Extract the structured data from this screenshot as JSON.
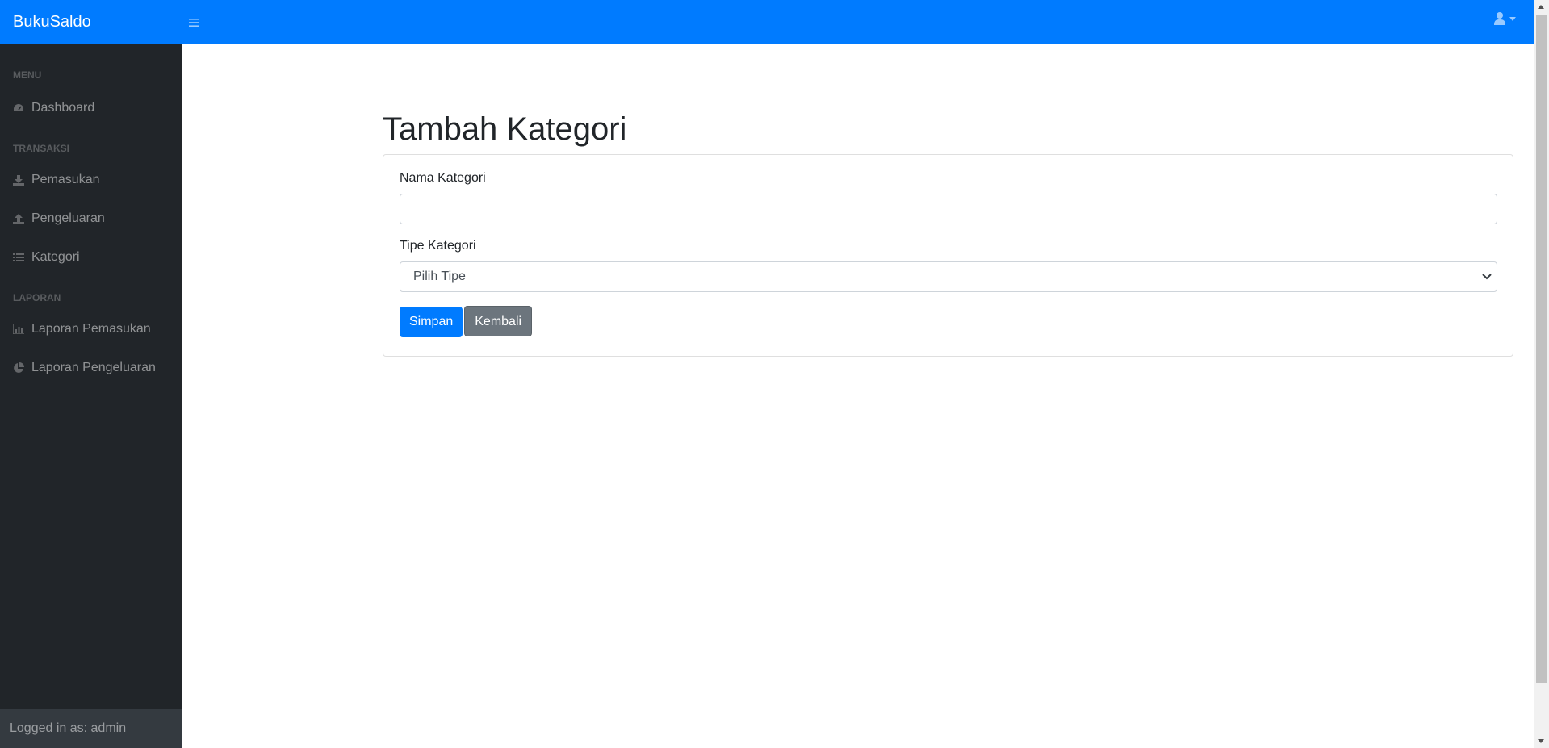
{
  "topbar": {
    "brand": "BukuSaldo"
  },
  "sidebar": {
    "sections": [
      {
        "heading": "MENU",
        "items": [
          {
            "label": "Dashboard",
            "icon": "tachometer-icon"
          }
        ]
      },
      {
        "heading": "TRANSAKSI",
        "items": [
          {
            "label": "Pemasukan",
            "icon": "download-icon"
          },
          {
            "label": "Pengeluaran",
            "icon": "upload-icon"
          },
          {
            "label": "Kategori",
            "icon": "list-icon"
          }
        ]
      },
      {
        "heading": "LAPORAN",
        "items": [
          {
            "label": "Laporan Pemasukan",
            "icon": "bar-chart-icon"
          },
          {
            "label": "Laporan Pengeluaran",
            "icon": "pie-chart-icon"
          }
        ]
      }
    ],
    "footer": "Logged in as: admin"
  },
  "main": {
    "title": "Tambah Kategori",
    "form": {
      "name_label": "Nama Kategori",
      "name_value": "",
      "type_label": "Tipe Kategori",
      "type_selected": "Pilih Tipe",
      "save_label": "Simpan",
      "back_label": "Kembali"
    }
  },
  "colors": {
    "primary": "#007bff",
    "sidebar_bg": "#212529",
    "secondary": "#6c757d"
  }
}
